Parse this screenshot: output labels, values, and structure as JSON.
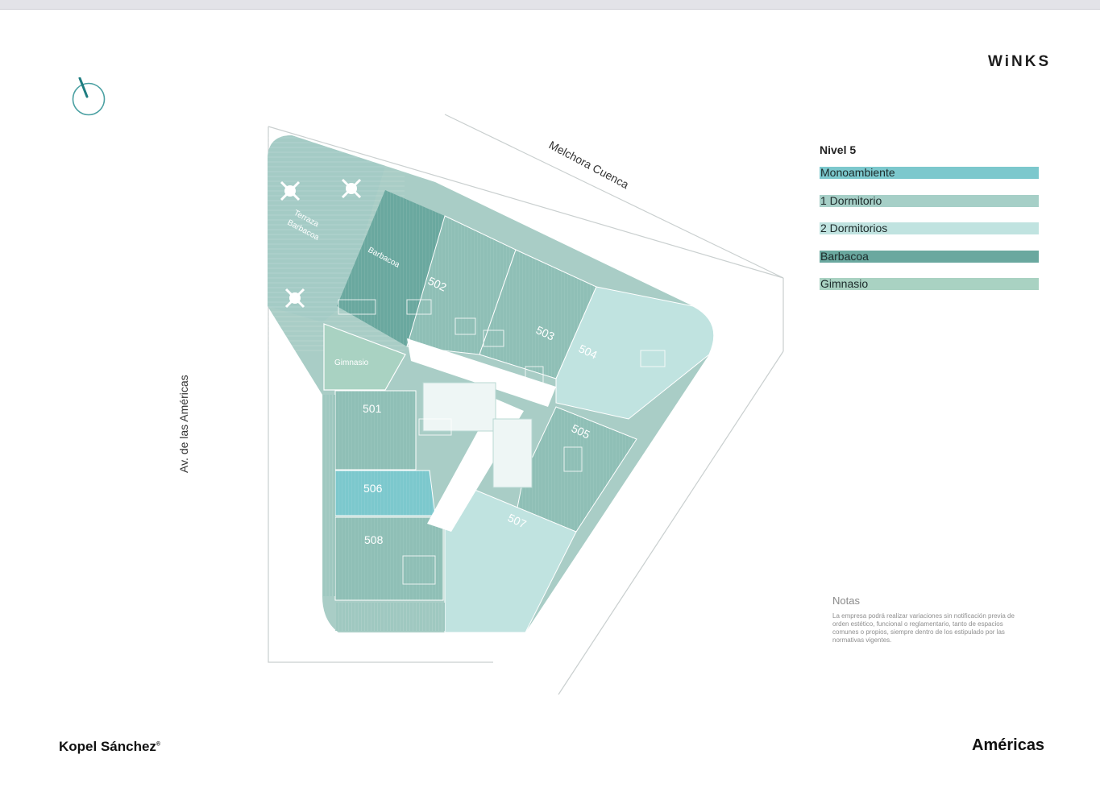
{
  "brand": "WiNKS",
  "streets": {
    "top": "Melchora Cuenca",
    "left": "Av. de las Américas"
  },
  "plan_labels": {
    "terraza": "Terraza\nBarbacoa",
    "barbacoa": "Barbacoa",
    "gimnasio": "Gimnasio",
    "units": [
      "502",
      "503",
      "504",
      "505",
      "501",
      "506",
      "508",
      "507"
    ]
  },
  "legend": {
    "title": "Nivel 5",
    "items": [
      {
        "label": "Monoambiente",
        "color": "#7cc8cd"
      },
      {
        "label": "1 Dormitorio",
        "color": "#a6cfc7"
      },
      {
        "label": "2 Dormitorios",
        "color": "#c0e3e0"
      },
      {
        "label": "Barbacoa",
        "color": "#6aa89f"
      },
      {
        "label": "Gimnasio",
        "color": "#a9d2c2"
      }
    ]
  },
  "notes": {
    "title": "Notas",
    "body": "La empresa podrá realizar variaciones sin notificación previa de orden estético, funcional o reglamentario, tanto de espacios comunes o propios, siempre dentro de los estipulado por las normativas vigentes."
  },
  "footer": {
    "left": "Kopel Sánchez",
    "left_mark": "®",
    "right": "Américas"
  }
}
